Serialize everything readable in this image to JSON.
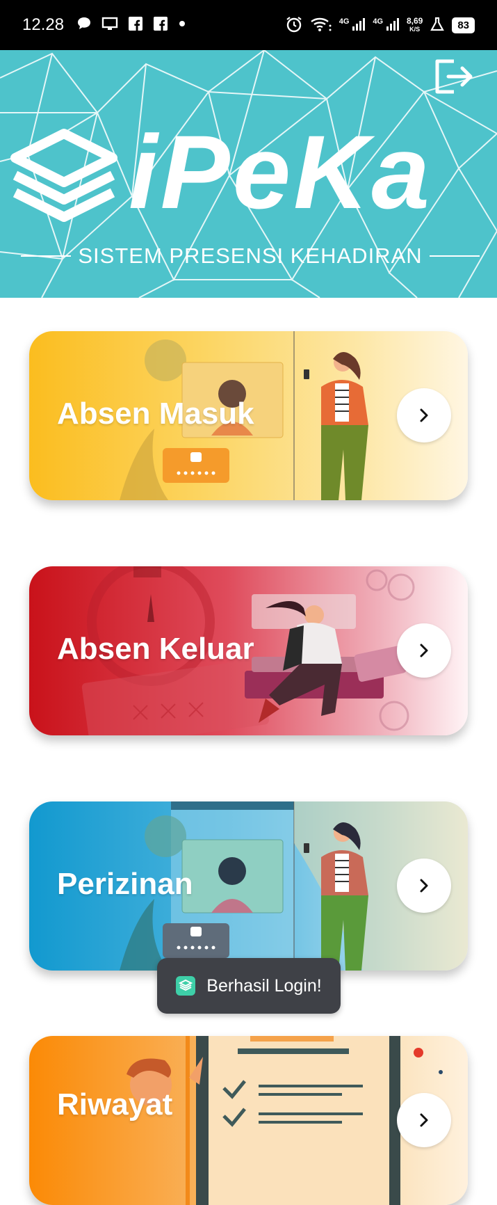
{
  "status_bar": {
    "time": "12.28",
    "network_speed_value": "8,69",
    "network_speed_unit": "K/S",
    "battery": "83",
    "signal_1": "4G",
    "signal_2": "4G"
  },
  "header": {
    "logo_text": "iPeKa",
    "logo_subtitle": "SISTEM PRESENSI KEHADIRAN"
  },
  "menu": [
    {
      "label": "Absen Masuk"
    },
    {
      "label": "Absen Keluar"
    },
    {
      "label": "Perizinan"
    },
    {
      "label": "Riwayat"
    }
  ],
  "toast": {
    "message": "Berhasil Login!"
  },
  "colors": {
    "banner": "#4ec3cb",
    "card_masuk": "#fbbd1f",
    "card_keluar": "#c9121a",
    "card_perizinan": "#1299cf",
    "card_riwayat": "#fb8a06",
    "toast_bg": "#3f4147"
  },
  "icons": {
    "logout": "logout-icon",
    "chevron": "chevron-right-icon"
  }
}
